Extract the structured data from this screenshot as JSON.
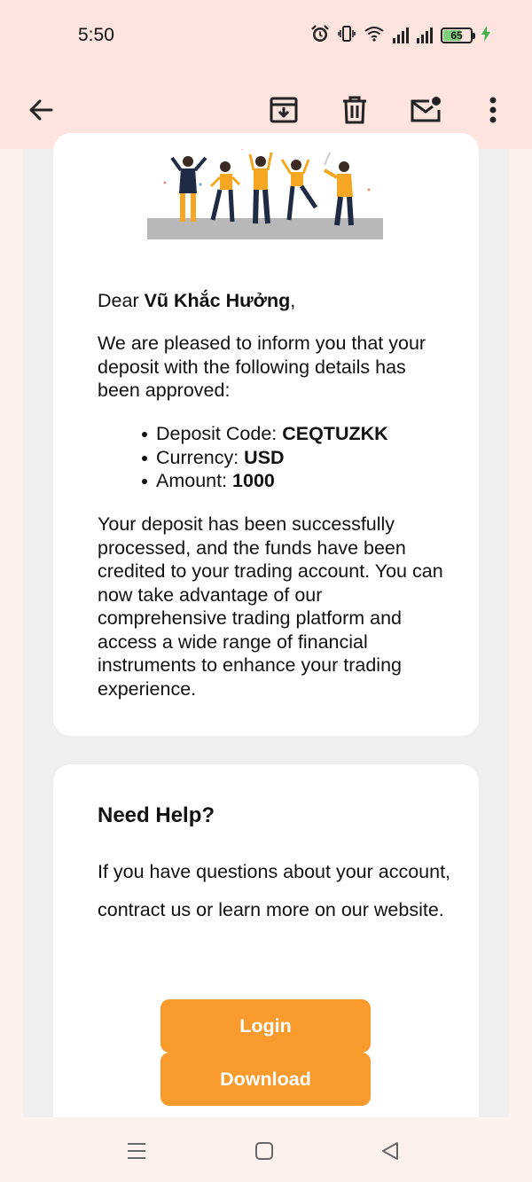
{
  "status_bar": {
    "time": "5:50",
    "battery_level": "65",
    "icons": [
      "alarm-icon",
      "vibrate-icon",
      "wifi-icon",
      "signal-icon",
      "signal-icon",
      "battery-icon",
      "charging-icon"
    ]
  },
  "toolbar": {
    "icons": [
      "back-arrow-icon",
      "archive-icon",
      "delete-icon",
      "mark-unread-icon",
      "more-options-icon"
    ]
  },
  "email": {
    "greeting_prefix": "Dear ",
    "recipient_name": "Vũ Khắc Hưởng",
    "greeting_suffix": ",",
    "intro": "We are pleased to inform you that your deposit with the following details has been approved:",
    "details": [
      {
        "label": "Deposit Code: ",
        "value": "CEQTUZKK"
      },
      {
        "label": "Currency: ",
        "value": "USD"
      },
      {
        "label": "Amount: ",
        "value": "1000"
      }
    ],
    "body": "Your deposit has been successfully processed, and the funds have been credited to your trading account. You can now take advantage of our comprehensive trading platform and access a wide range of financial instruments to enhance your trading experience."
  },
  "help": {
    "title": "Need Help?",
    "text": "If you have questions about your account, contract us or learn more on our website.",
    "login_label": "Login",
    "download_label": "Download"
  },
  "colors": {
    "accent": "#f89a2c",
    "header_bg": "#fde4df",
    "page_bg": "#efefef"
  }
}
